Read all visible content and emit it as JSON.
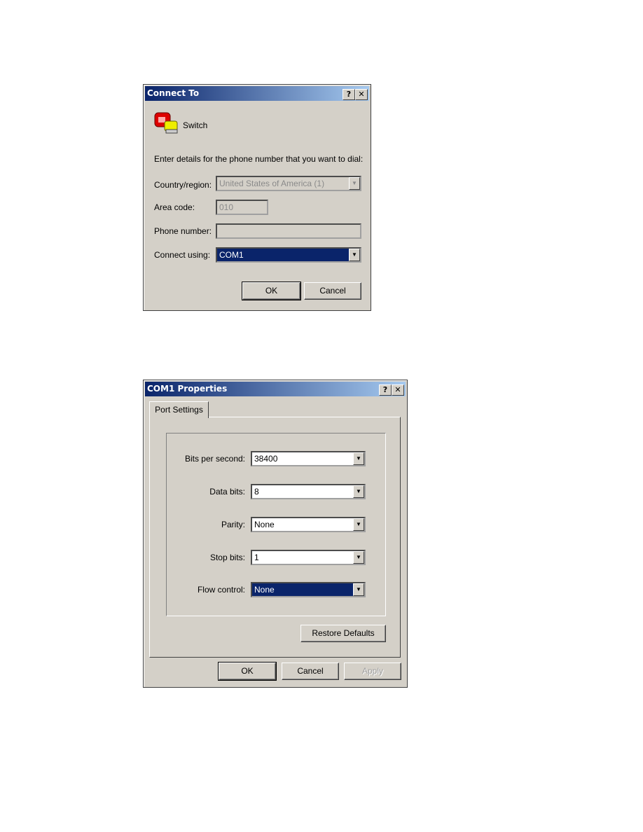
{
  "connect_dialog": {
    "title": "Connect To",
    "help_button": "?",
    "close_button": "✕",
    "connection_name": "Switch",
    "instruction": "Enter details for the phone number that you want to dial:",
    "country_label": "Country/region:",
    "country_value": "United States of America (1)",
    "area_code_label": "Area code:",
    "area_code_value": "010",
    "phone_label": "Phone number:",
    "phone_value": "",
    "connect_using_label": "Connect using:",
    "connect_using_value": "COM1",
    "ok_label": "OK",
    "cancel_label": "Cancel"
  },
  "properties_dialog": {
    "title": "COM1 Properties",
    "help_button": "?",
    "close_button": "✕",
    "tab": "Port Settings",
    "fields": [
      {
        "label": "Bits per second:",
        "value": "38400"
      },
      {
        "label": "Data bits:",
        "value": "8"
      },
      {
        "label": "Parity:",
        "value": "None"
      },
      {
        "label": "Stop bits:",
        "value": "1"
      },
      {
        "label": "Flow control:",
        "value": "None"
      }
    ],
    "restore_label": "Restore Defaults",
    "ok_label": "OK",
    "cancel_label": "Cancel",
    "apply_label": "Apply"
  }
}
